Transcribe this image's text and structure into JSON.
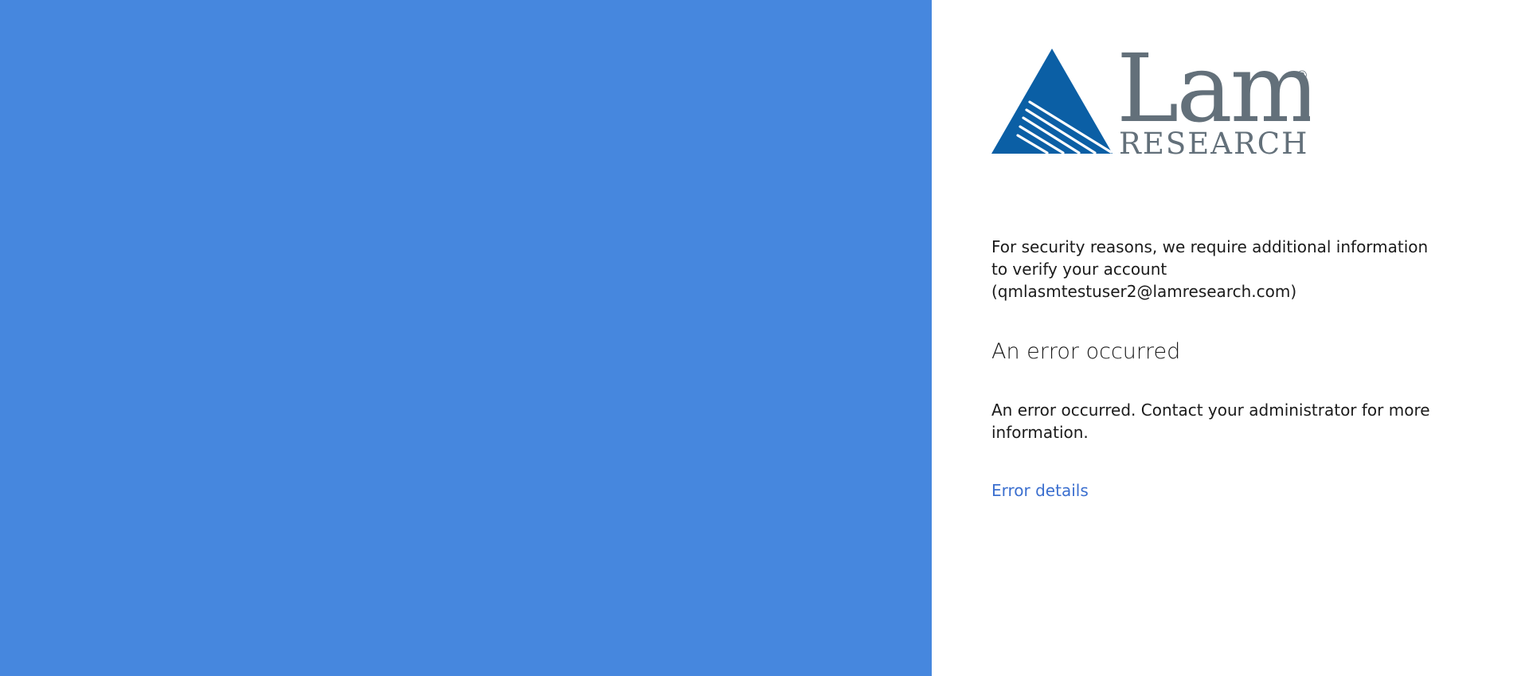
{
  "brand": {
    "logo_main": "Lam",
    "logo_sub": "RESEARCH",
    "logo_registered": "®",
    "accent_blue": "#4687de",
    "logo_triangle_blue": "#0b5fa5",
    "logo_gray": "#63707a"
  },
  "message": {
    "intro": "For security reasons, we require additional information to verify your account",
    "account": "(qmlasmtestuser2@lamresearch.com)",
    "error_title": "An error occurred",
    "error_description": "An error occurred. Contact your administrator for more information.",
    "error_details_link": "Error details"
  }
}
